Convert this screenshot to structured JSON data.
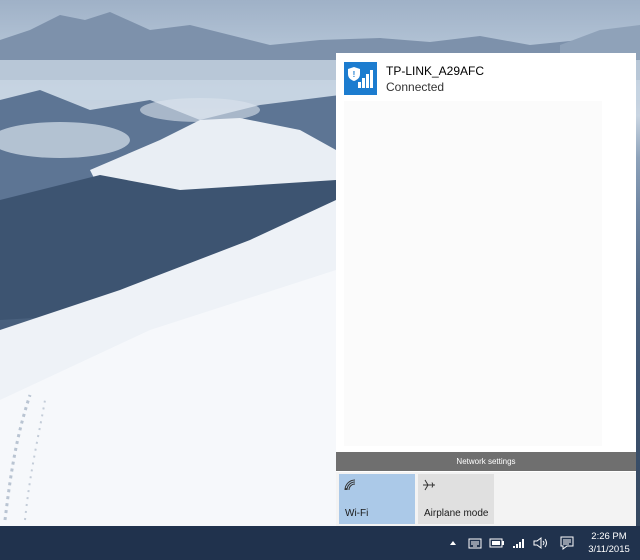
{
  "flyout": {
    "network": {
      "name": "TP-LINK_A29AFC",
      "status": "Connected"
    },
    "settings_label": "Network settings",
    "tiles": [
      {
        "label": "Wi-Fi",
        "icon": "wifi-icon",
        "active": true
      },
      {
        "label": "Airplane mode",
        "icon": "airplane-icon",
        "active": false
      }
    ]
  },
  "taskbar": {
    "clock": {
      "time": "2:26 PM",
      "date": "3/11/2015"
    },
    "tray_icons": [
      "show-hidden-icons-chevron",
      "keyboard-icon",
      "battery-icon",
      "network-signal-icon",
      "volume-icon",
      "action-center-icon"
    ]
  },
  "colors": {
    "accent": "#1c7ccf",
    "wifi_tile": "#abc9e8",
    "taskbar": "#20324d",
    "settings_bar": "#6f6f6f"
  }
}
